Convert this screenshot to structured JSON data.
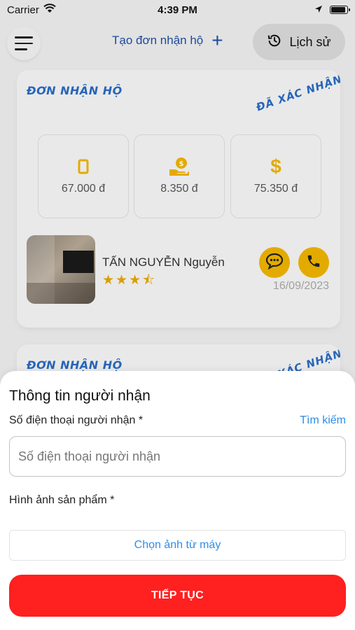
{
  "status_bar": {
    "carrier": "Carrier",
    "time": "4:39 PM",
    "battery_level": 0.9
  },
  "header": {
    "create_order_label": "Tạo đơn nhận hộ",
    "create_order_icon": "plus-icon",
    "history_label": "Lịch sử",
    "history_icon": "history-icon"
  },
  "orders": [
    {
      "title": "ĐƠN NHẬN HỘ",
      "status": "ĐÃ XÁC NHẬN",
      "stats": [
        {
          "icon": "box-icon",
          "value": "67.000 đ"
        },
        {
          "icon": "hand-coin-icon",
          "value": "8.350 đ"
        },
        {
          "icon": "dollar-icon",
          "value": "75.350 đ"
        }
      ],
      "sender": {
        "name": "TẤN NGUYỄN Nguyễn",
        "rating": 3.5,
        "stars_text": "★★★⯪"
      },
      "date": "16/09/2023"
    },
    {
      "title": "ĐƠN NHẬN HỘ",
      "status": "ĐÃ XÁC NHẬN"
    }
  ],
  "sheet": {
    "title": "Thông tin người nhận",
    "phone_label": "Số điện thoại người nhận *",
    "search_link": "Tìm kiếm",
    "phone_placeholder": "Số điện thoại người nhận",
    "phone_value": "",
    "image_label": "Hình ảnh sản phẩm *",
    "choose_image_label": "Chọn ảnh từ máy",
    "continue_label": "TIẾP TỤC"
  },
  "colors": {
    "primary_blue": "#2a6cc5",
    "link_blue": "#2f8ee6",
    "accent_yellow": "#f2b600",
    "button_red": "#ff2020"
  }
}
